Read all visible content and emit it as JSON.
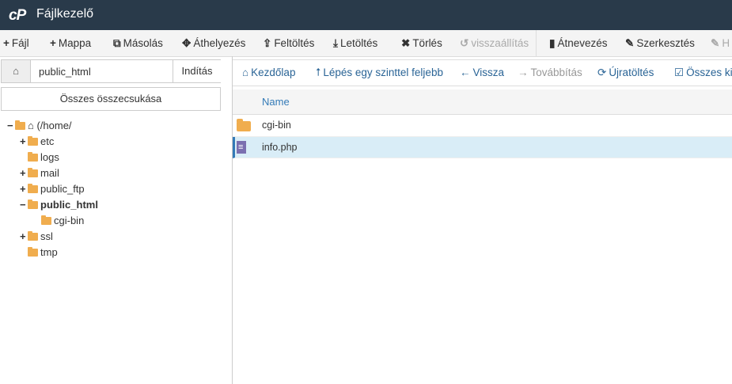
{
  "app": {
    "logo": "cP",
    "title": "Fájlkezelő"
  },
  "toolbar": {
    "items": [
      {
        "icon": "+",
        "label": "Fájl",
        "disabled": false
      },
      {
        "icon": "+",
        "label": "Mappa",
        "disabled": false
      },
      {
        "icon": "⧉",
        "label": "Másolás",
        "disabled": false
      },
      {
        "icon": "✥",
        "label": "Áthelyezés",
        "disabled": false
      },
      {
        "icon": "⇪",
        "label": "Feltöltés",
        "disabled": false
      },
      {
        "icon": "⤓",
        "label": "Letöltés",
        "disabled": false
      },
      {
        "icon": "✖",
        "label": "Törlés",
        "disabled": false
      },
      {
        "icon": "↺",
        "label": "visszaállítás",
        "disabled": true
      },
      {
        "icon": "▮",
        "label": "Átnevezés",
        "disabled": false
      },
      {
        "icon": "✎",
        "label": "Szerkesztés",
        "disabled": false
      },
      {
        "icon": "✎",
        "label": "H",
        "disabled": true
      }
    ]
  },
  "path": {
    "value": "public_html",
    "go_label": "Indítás"
  },
  "collapse_label": "Összes összecsukása",
  "tree": [
    {
      "toggle": "−",
      "label": "(/home/",
      "bold": false
    },
    {
      "toggle": "+",
      "label": "etc",
      "bold": false
    },
    {
      "toggle": "",
      "label": "logs",
      "bold": false
    },
    {
      "toggle": "+",
      "label": "mail",
      "bold": false
    },
    {
      "toggle": "+",
      "label": "public_ftp",
      "bold": false
    },
    {
      "toggle": "−",
      "label": "public_html",
      "bold": true
    },
    {
      "toggle": "",
      "label": "cgi-bin",
      "bold": false
    },
    {
      "toggle": "+",
      "label": "ssl",
      "bold": false
    },
    {
      "toggle": "",
      "label": "tmp",
      "bold": false
    }
  ],
  "nav": {
    "items": [
      {
        "icon": "⌂",
        "label": "Kezdőlap",
        "disabled": false
      },
      {
        "icon": "⭡",
        "label": "Lépés egy szinttel feljebb",
        "disabled": false
      },
      {
        "icon": "←",
        "label": "Vissza",
        "disabled": false
      },
      {
        "icon": "→",
        "label": "Továbbítás",
        "disabled": true
      },
      {
        "icon": "⟳",
        "label": "Újratöltés",
        "disabled": false
      },
      {
        "icon": "☑",
        "label": "Összes kij",
        "disabled": false
      }
    ]
  },
  "files": {
    "header_name": "Name",
    "rows": [
      {
        "name": "cgi-bin",
        "type": "folder",
        "selected": false
      },
      {
        "name": "info.php",
        "type": "file",
        "selected": true
      }
    ]
  },
  "colors": {
    "topbar": "#293a4a",
    "link": "#2a6496",
    "folder": "#f0ad4e",
    "selected_row": "#d9edf7"
  }
}
